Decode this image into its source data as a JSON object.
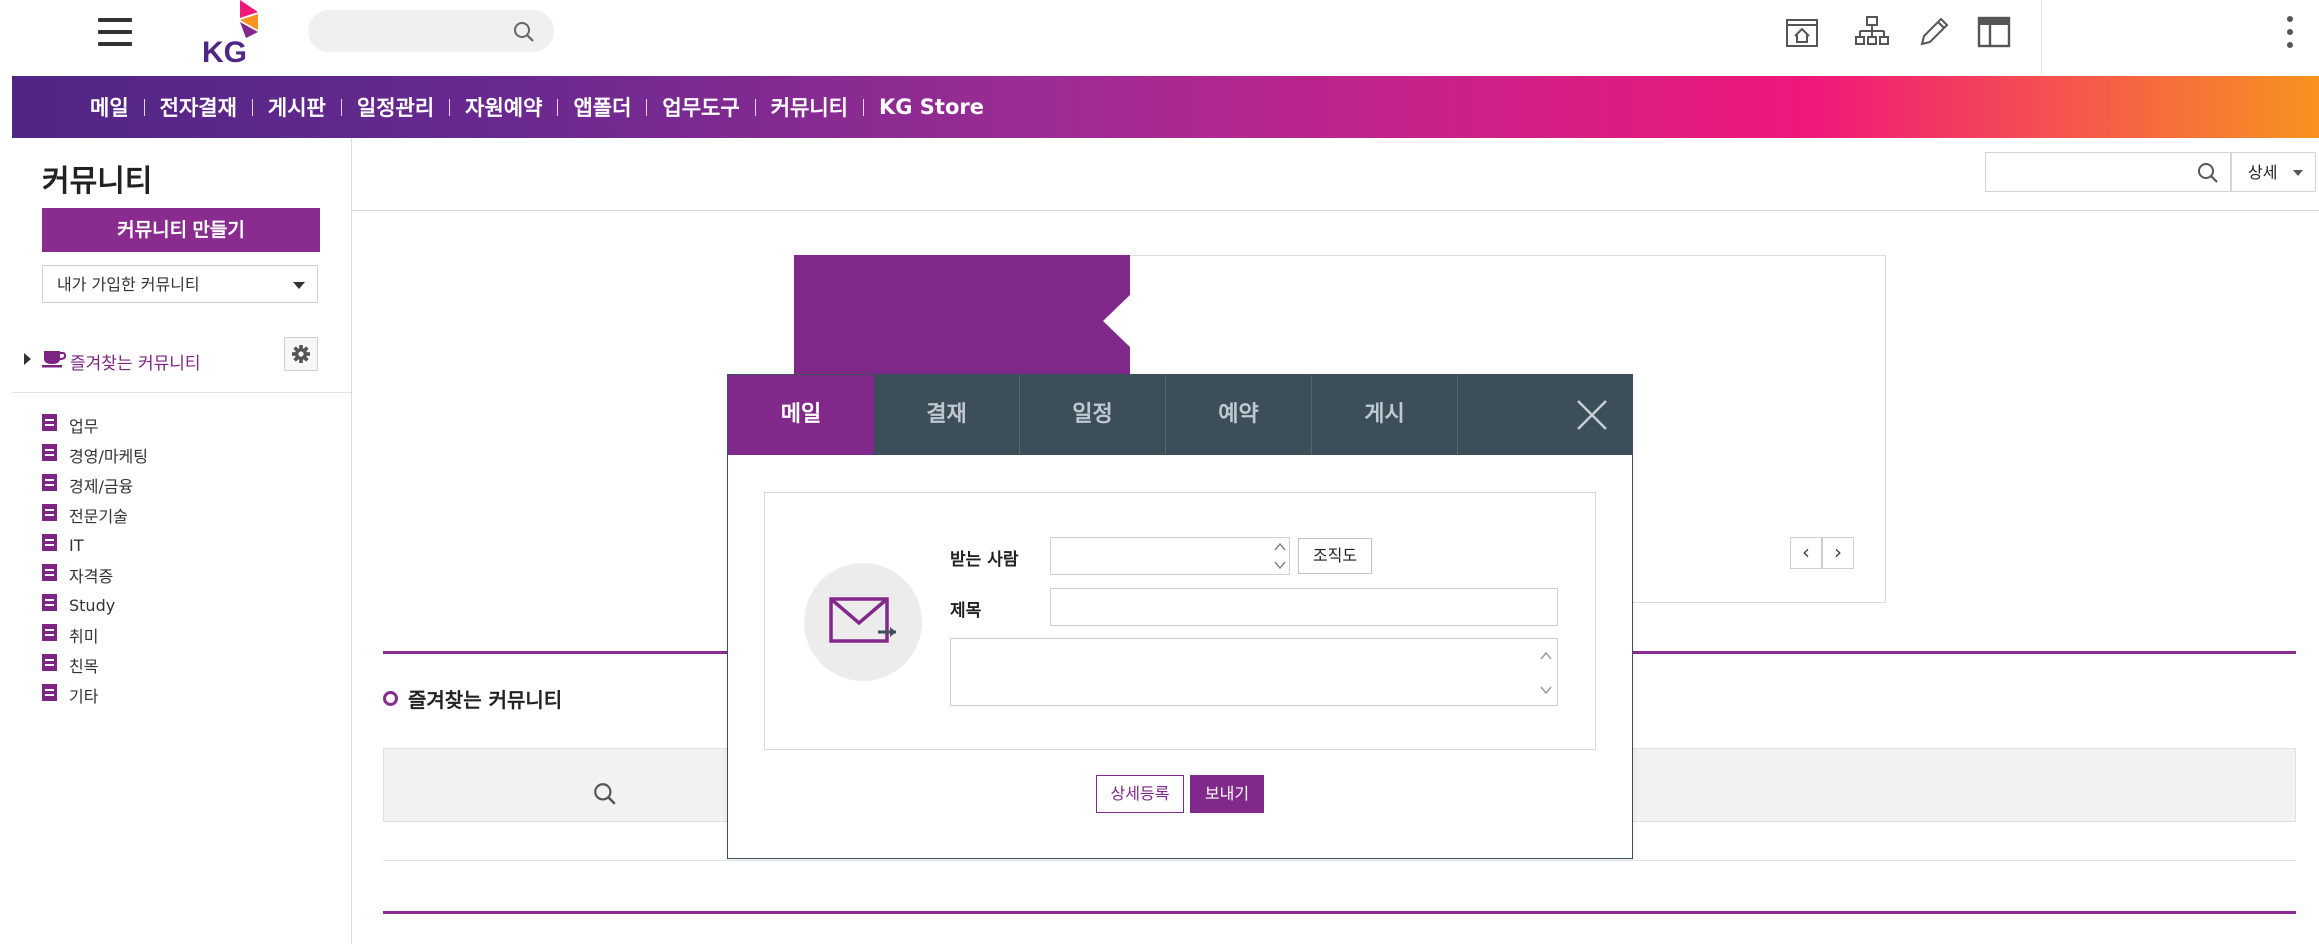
{
  "header": {
    "logo_text": "KG",
    "icons": [
      "home-icon",
      "org-chart-icon",
      "pencil-icon",
      "layout-icon"
    ]
  },
  "gnb": {
    "items": [
      "메일",
      "전자결재",
      "게시판",
      "일정관리",
      "자원예약",
      "앱폴더",
      "업무도구",
      "커뮤니티",
      "KG Store"
    ]
  },
  "sidebar": {
    "title": "커뮤니티",
    "create_button": "커뮤니티 만들기",
    "select_value": "내가 가입한 커뮤니티",
    "favorites_label": "즐겨찾는 커뮤니티",
    "categories": [
      "업무",
      "경영/마케팅",
      "경제/금융",
      "전문기술",
      "IT",
      "자격증",
      "Study",
      "취미",
      "친목",
      "기타"
    ]
  },
  "main": {
    "search_detail": "상세",
    "pager_prev": "‹",
    "pager_next": "›",
    "favorites_section_title": "즐겨찾는 커뮤니티"
  },
  "popup": {
    "tabs": [
      "메일",
      "결재",
      "일정",
      "예약",
      "게시"
    ],
    "active_tab": "메일",
    "recipient_label": "받는 사람",
    "org_button": "조직도",
    "subject_label": "제목",
    "detail_button": "상세등록",
    "send_button": "보내기"
  },
  "colors": {
    "brand_purple": "#80298a",
    "popup_header": "#3b4e5a",
    "gnb_gradient_start": "#4f2585",
    "gnb_gradient_end": "#f7931e"
  }
}
